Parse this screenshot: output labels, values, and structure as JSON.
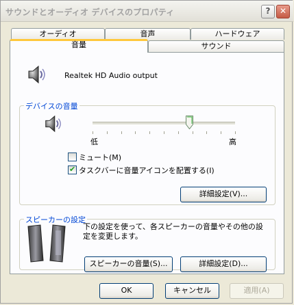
{
  "window": {
    "title": "サウンドとオーディオ デバイスのプロパティ",
    "help_icon": "?",
    "close_icon": "✕"
  },
  "tabs": {
    "row_back": [
      "オーディオ",
      "音声",
      "ハードウェア"
    ],
    "row_front": [
      "音量",
      "サウンド"
    ],
    "active": "音量"
  },
  "device": {
    "name": "Realtek HD Audio output",
    "icon": "speaker-icon"
  },
  "device_volume": {
    "group_title": "デバイスの音量",
    "slider_low_label": "低",
    "slider_high_label": "高",
    "slider_value": 0.68,
    "mute_label": "ミュート(M)",
    "mute_checked": false,
    "taskbar_label": "タスクバーに音量アイコンを配置する(I)",
    "taskbar_checked": true,
    "advanced_button": "詳細設定(V)..."
  },
  "speaker_settings": {
    "group_title": "スピーカーの設定",
    "description": "下の設定を使って、各スピーカーの音量やその他の設定を変更します。",
    "speaker_volume_button": "スピーカーの音量(S)...",
    "advanced_button": "詳細設定(D)..."
  },
  "footer": {
    "ok": "OK",
    "cancel": "キャンセル",
    "apply": "適用(A)"
  }
}
